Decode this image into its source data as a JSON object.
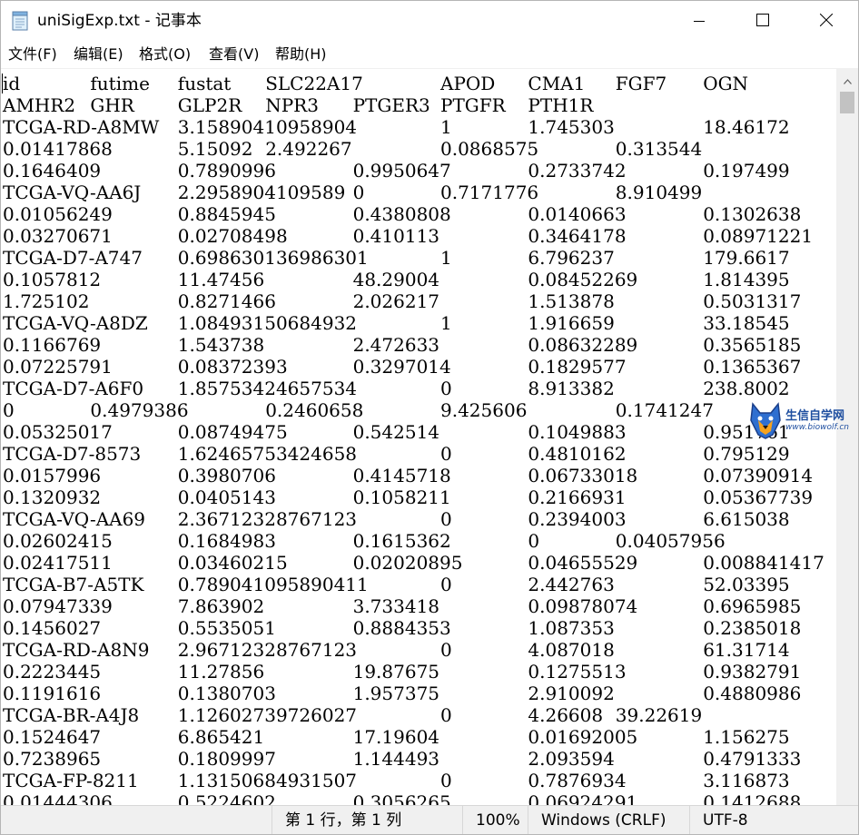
{
  "window": {
    "title": "uniSigExp.txt - 记事本",
    "icons": {
      "app": "notepad-icon",
      "minimize": "minimize-icon",
      "maximize": "maximize-icon",
      "close": "close-icon"
    }
  },
  "menu": [
    "文件(F)",
    "编辑(E)",
    "格式(O)",
    "查看(V)",
    "帮助(H)"
  ],
  "lines": [
    [
      "id",
      "futime",
      "fustat",
      "SLC22A17",
      "APOD",
      "CMA1",
      "FGF7",
      "OGN"
    ],
    [
      "AMHR2",
      "GHR",
      "GLP2R",
      "NPR3",
      "PTGER3",
      "PTGFR",
      "PTH1R"
    ],
    [
      "TCGA-RD-A8MW",
      "3.15890410958904",
      "1",
      "1.745303",
      "18.46172"
    ],
    [
      "0.01417868",
      "5.15092",
      "2.492267",
      "0.0868575",
      "0.313544"
    ],
    [
      "0.1646409",
      "0.7890996",
      "0.9950647",
      "0.2733742",
      "0.197499"
    ],
    [
      "TCGA-VQ-AA6J",
      "2.2958904109589",
      "0",
      "0.7171776",
      "8.910499"
    ],
    [
      "0.01056249",
      "0.8845945",
      "0.4380808",
      "0.0140663",
      "0.1302638"
    ],
    [
      "0.03270671",
      "0.02708498",
      "0.410113",
      "0.3464178",
      "0.08971221"
    ],
    [
      "TCGA-D7-A747",
      "0.698630136986301",
      "1",
      "6.796237",
      "179.6617"
    ],
    [
      "0.1057812",
      "11.47456",
      "48.29004",
      "0.08452269",
      "1.814395"
    ],
    [
      "1.725102",
      "0.8271466",
      "2.026217",
      "1.513878",
      "0.5031317"
    ],
    [
      "TCGA-VQ-A8DZ",
      "1.08493150684932",
      "1",
      "1.916659",
      "33.18545"
    ],
    [
      "0.1166769",
      "1.543738",
      "2.472633",
      "0.08632289",
      "0.3565185"
    ],
    [
      "0.07225791",
      "0.08372393",
      "0.3297014",
      "0.1829577",
      "0.1365367"
    ],
    [
      "TCGA-D7-A6F0",
      "1.85753424657534",
      "0",
      "8.913382",
      "238.8002"
    ],
    [
      "0",
      "0.4979386",
      "0.2460658",
      "9.425606",
      "0.1741247"
    ],
    [
      "0.05325017",
      "0.08749475",
      "0.542514",
      "0.1049883",
      "0.951761"
    ],
    [
      "TCGA-D7-8573",
      "1.62465753424658",
      "0",
      "0.4810162",
      "0.795129"
    ],
    [
      "0.0157996",
      "0.3980706",
      "0.4145718",
      "0.06733018",
      "0.07390914"
    ],
    [
      "0.1320932",
      "0.0405143",
      "0.1058211",
      "0.2166931",
      "0.05367739"
    ],
    [
      "TCGA-VQ-AA69",
      "2.36712328767123",
      "0",
      "0.2394003",
      "6.615038"
    ],
    [
      "0.02602415",
      "0.1684983",
      "0.1615362",
      "0",
      "0.04057956"
    ],
    [
      "0.02417511",
      "0.03460215",
      "0.02020895",
      "0.04655529",
      "0.008841417"
    ],
    [
      "TCGA-B7-A5TK",
      "0.789041095890411",
      "0",
      "2.442763",
      "52.03395"
    ],
    [
      "0.07947339",
      "7.863902",
      "3.733418",
      "0.09878074",
      "0.6965985"
    ],
    [
      "0.1456027",
      "0.5535051",
      "0.8884353",
      "1.087353",
      "0.2385018"
    ],
    [
      "TCGA-RD-A8N9",
      "2.96712328767123",
      "0",
      "4.087018",
      "61.31714"
    ],
    [
      "0.2223445",
      "11.27856",
      "19.87675",
      "0.1275513",
      "0.9382791"
    ],
    [
      "0.1191616",
      "0.1380703",
      "1.957375",
      "2.910092",
      "0.4880986"
    ],
    [
      "TCGA-BR-A4J8",
      "1.12602739726027",
      "0",
      "4.26608",
      "39.22619"
    ],
    [
      "0.1524647",
      "6.865421",
      "17.19604",
      "0.01692005",
      "1.156275"
    ],
    [
      "0.7238965",
      "0.1809997",
      "1.144493",
      "2.093594",
      "0.4791333"
    ],
    [
      "TCGA-FP-8211",
      "1.13150684931507",
      "0",
      "0.7876934",
      "3.116873"
    ],
    [
      "0.01444306",
      "0.5224602",
      "0.3056265",
      "0.06924291",
      "0.1412688"
    ]
  ],
  "status": {
    "position": "第 1 行，第 1 列",
    "zoom": "100%",
    "line_ending": "Windows (CRLF)",
    "encoding": "UTF-8"
  },
  "watermark": {
    "name": "生信自学网",
    "url": "www.biowolf.cn"
  }
}
